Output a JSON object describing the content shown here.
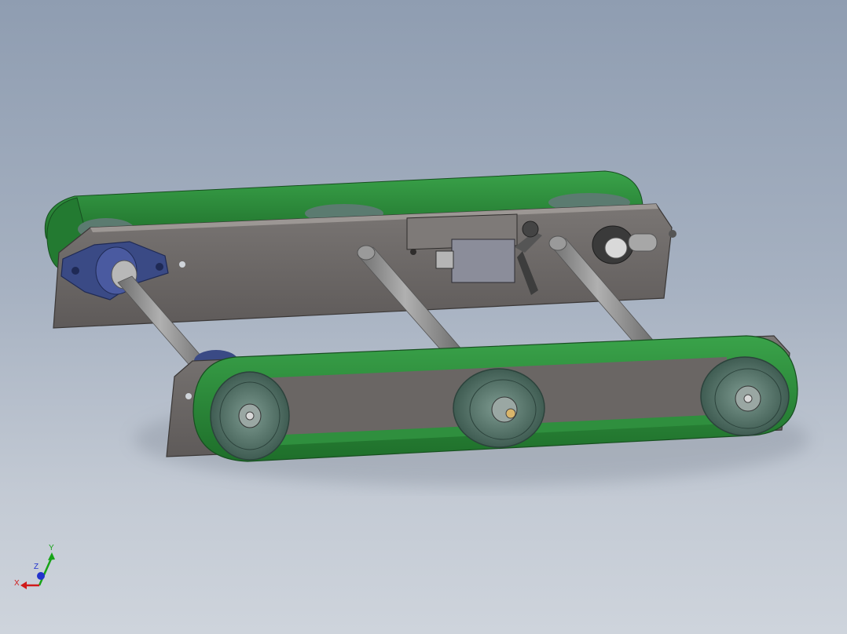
{
  "viewport": {
    "background_top": "#8f9db1",
    "background_bottom": "#ced4dc"
  },
  "model": {
    "plate_color": "#6f6b69",
    "belt_color": "#2a8a3a",
    "pulley_color": "#5d7a70",
    "bearing_color": "#3f4f8a",
    "shaft_color": "#8c8c8c"
  },
  "triad": {
    "x_label": "X",
    "y_label": "Y",
    "z_label": "Z",
    "x_color": "#d01a1a",
    "y_color": "#17a317",
    "z_color": "#2233cc"
  }
}
